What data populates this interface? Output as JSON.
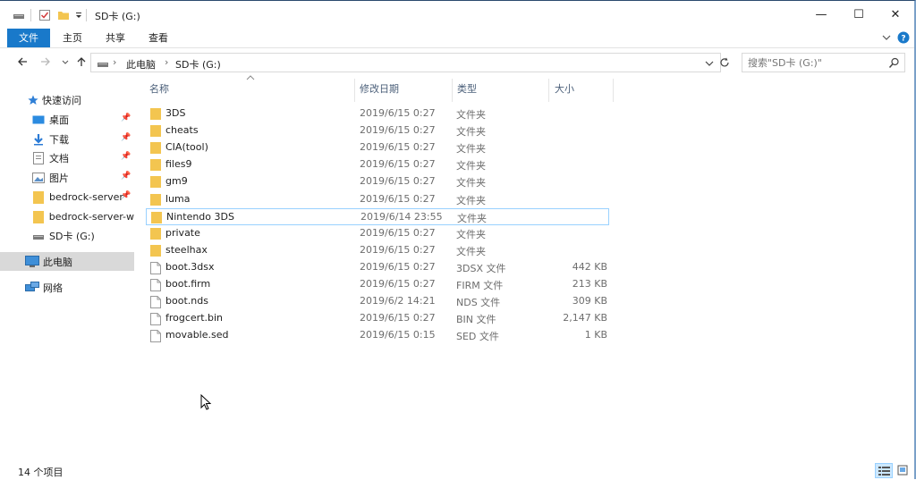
{
  "window": {
    "title": "SD卡 (G:)",
    "minimize_glyph": "—",
    "maximize_glyph": "☐",
    "close_glyph": "✕"
  },
  "ribbon": {
    "tabs": [
      "文件",
      "主页",
      "共享",
      "查看"
    ]
  },
  "address": {
    "crumbs": [
      "此电脑",
      "SD卡 (G:)"
    ],
    "search_placeholder": "搜索\"SD卡 (G:)\""
  },
  "nav": {
    "quick_access": "快速访问",
    "items": [
      {
        "label": "桌面",
        "icon": "desktop-icon",
        "pinned": true
      },
      {
        "label": "下载",
        "icon": "download-icon",
        "pinned": true
      },
      {
        "label": "文档",
        "icon": "document-icon",
        "pinned": true
      },
      {
        "label": "图片",
        "icon": "picture-icon",
        "pinned": true
      },
      {
        "label": "bedrock-server",
        "icon": "folder-icon",
        "pinned": true
      },
      {
        "label": "bedrock-server-w",
        "icon": "folder-icon",
        "pinned": false
      },
      {
        "label": "SD卡 (G:)",
        "icon": "drive-icon",
        "pinned": false
      }
    ],
    "this_pc": "此电脑",
    "network": "网络"
  },
  "columns": {
    "name": "名称",
    "date": "修改日期",
    "type": "类型",
    "size": "大小"
  },
  "files": [
    {
      "name": "3DS",
      "date": "2019/6/15 0:27",
      "type": "文件夹",
      "size": "",
      "kind": "folder"
    },
    {
      "name": "cheats",
      "date": "2019/6/15 0:27",
      "type": "文件夹",
      "size": "",
      "kind": "folder"
    },
    {
      "name": "CIA(tool)",
      "date": "2019/6/15 0:27",
      "type": "文件夹",
      "size": "",
      "kind": "folder"
    },
    {
      "name": "files9",
      "date": "2019/6/15 0:27",
      "type": "文件夹",
      "size": "",
      "kind": "folder"
    },
    {
      "name": "gm9",
      "date": "2019/6/15 0:27",
      "type": "文件夹",
      "size": "",
      "kind": "folder"
    },
    {
      "name": "luma",
      "date": "2019/6/15 0:27",
      "type": "文件夹",
      "size": "",
      "kind": "folder"
    },
    {
      "name": "Nintendo 3DS",
      "date": "2019/6/14 23:55",
      "type": "文件夹",
      "size": "",
      "kind": "folder"
    },
    {
      "name": "private",
      "date": "2019/6/15 0:27",
      "type": "文件夹",
      "size": "",
      "kind": "folder"
    },
    {
      "name": "steelhax",
      "date": "2019/6/15 0:27",
      "type": "文件夹",
      "size": "",
      "kind": "folder"
    },
    {
      "name": "boot.3dsx",
      "date": "2019/6/15 0:27",
      "type": "3DSX 文件",
      "size": "442 KB",
      "kind": "file"
    },
    {
      "name": "boot.firm",
      "date": "2019/6/15 0:27",
      "type": "FIRM 文件",
      "size": "213 KB",
      "kind": "file"
    },
    {
      "name": "boot.nds",
      "date": "2019/6/2 14:21",
      "type": "NDS 文件",
      "size": "309 KB",
      "kind": "file"
    },
    {
      "name": "frogcert.bin",
      "date": "2019/6/15 0:27",
      "type": "BIN 文件",
      "size": "2,147 KB",
      "kind": "file"
    },
    {
      "name": "movable.sed",
      "date": "2019/6/15 0:15",
      "type": "SED 文件",
      "size": "1 KB",
      "kind": "file"
    }
  ],
  "status": {
    "item_count": "14 个项目"
  },
  "colors": {
    "accent": "#1979ca",
    "folder": "#f3c550",
    "selection": "#d9d9d9",
    "focus_border": "#99d1ff"
  }
}
